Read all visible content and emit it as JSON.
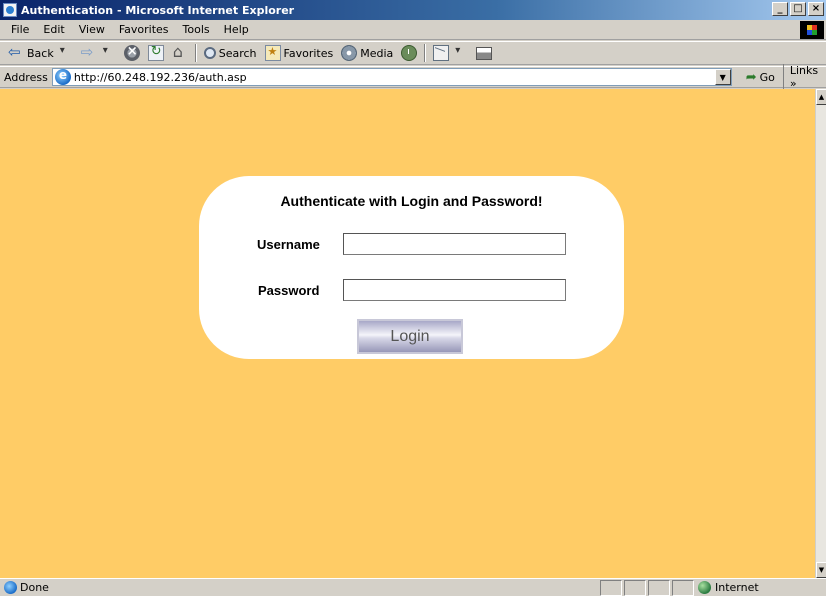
{
  "window": {
    "title": "Authentication - Microsoft Internet Explorer",
    "buttons": [
      "_",
      "□",
      "×"
    ]
  },
  "menu": [
    "File",
    "Edit",
    "View",
    "Favorites",
    "Tools",
    "Help"
  ],
  "toolbar": {
    "back_label": "Back",
    "search_label": "Search",
    "favorites_label": "Favorites",
    "media_label": "Media"
  },
  "address": {
    "label": "Address",
    "url": "http://60.248.192.236/auth.asp",
    "go_label": "Go",
    "links_label": "Links »"
  },
  "page": {
    "background": "#ffcc66",
    "auth_title": "Authenticate with Login and Password!",
    "username_label": "Username",
    "username_value": "",
    "password_label": "Password",
    "password_value": "",
    "login_label": "Login"
  },
  "status": {
    "text": "Done",
    "zone": "Internet"
  }
}
